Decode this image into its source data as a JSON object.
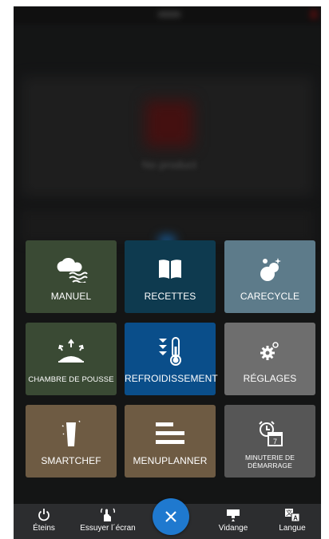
{
  "tiles": [
    {
      "label": "MANUEL",
      "icon": "cloud-steam-icon",
      "color": "#3a4a34"
    },
    {
      "label": "RECETTES",
      "icon": "book-icon",
      "color": "#0e3a4f"
    },
    {
      "label": "CARECYCLE",
      "icon": "bubbles-icon",
      "color": "#5d7b8a"
    },
    {
      "label": "CHAMBRE DE POUSSE",
      "icon": "rising-dough-icon",
      "color": "#3a4a34"
    },
    {
      "label": "REFROIDISSEMENT",
      "icon": "thermometer-cool-icon",
      "color": "#0a4e8a"
    },
    {
      "label": "RÉGLAGES",
      "icon": "gear-icon",
      "color": "#6e6e6e"
    },
    {
      "label": "SMARTCHEF",
      "icon": "glass-icon",
      "color": "#6e5b43"
    },
    {
      "label": "MENUPLANNER",
      "icon": "menu-list-icon",
      "color": "#6e5b43"
    },
    {
      "label": "MINUTERIE DE DÉMARRAGE",
      "icon": "alarm-calendar-icon",
      "color": "#565656"
    }
  ],
  "bottombar": {
    "power_label": "Éteins",
    "wipe_label": "Essuyer l´écran",
    "drain_label": "Vidange",
    "language_label": "Langue"
  },
  "background": {
    "blurred_text": "No product"
  },
  "colors": {
    "fab": "#1f79cf",
    "bottombar": "#2c2d2f"
  }
}
